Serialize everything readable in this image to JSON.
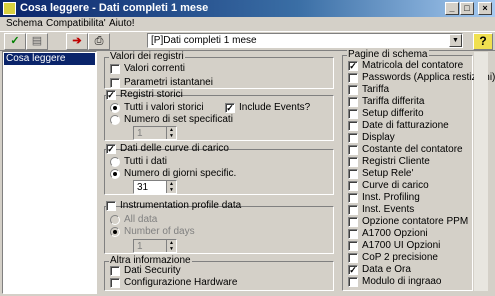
{
  "window": {
    "title": "Cosa leggere - Dati completi 1 mese"
  },
  "menu": [
    "Schema",
    "Compatibilita'",
    "Aiuto!"
  ],
  "toolbar": {
    "profile": "[P]Dati completi 1 mese",
    "help_label": "?"
  },
  "sidebar": {
    "items": [
      "Cosa leggere"
    ]
  },
  "valori_registri": {
    "title": "Valori dei registri",
    "items": [
      {
        "label": "Valori correnti",
        "checked": false
      },
      {
        "label": "Parametri istantanei",
        "checked": false
      }
    ]
  },
  "registri_storici": {
    "title": "Registri storici",
    "checked": true,
    "opt_all": "Tutti i valori storici",
    "opt_num": "Numero di set specificati",
    "include_events": "Include Events?",
    "spin_value": "1"
  },
  "curve_carico": {
    "title": "Dati delle curve di carico",
    "checked": true,
    "opt_all": "Tutti i dati",
    "opt_num": "Numero di giorni specific.",
    "spin_value": "31"
  },
  "instrumentation": {
    "title": "Instrumentation profile data",
    "checked": false,
    "opt_all": "All data",
    "opt_num": "Number of days",
    "spin_value": "1"
  },
  "altra_info": {
    "title": "Altra informazione",
    "items": [
      {
        "label": "Dati Security",
        "checked": false
      },
      {
        "label": "Configurazione Hardware",
        "checked": false
      }
    ]
  },
  "pagine_schema": {
    "title": "Pagine di schema",
    "items": [
      {
        "label": "Matricola del contatore",
        "checked": true
      },
      {
        "label": "Passwords (Applica restizioni)",
        "checked": false
      },
      {
        "label": "Tariffa",
        "checked": false
      },
      {
        "label": "Tariffa differita",
        "checked": false
      },
      {
        "label": "Setup differito",
        "checked": false
      },
      {
        "label": "Date di fatturazione",
        "checked": false
      },
      {
        "label": "Display",
        "checked": false
      },
      {
        "label": "Costante del contatore",
        "checked": false
      },
      {
        "label": "Registri Cliente",
        "checked": false
      },
      {
        "label": "Setup Rele'",
        "checked": false
      },
      {
        "label": "Curve di carico",
        "checked": false
      },
      {
        "label": "Inst. Profiling",
        "checked": false
      },
      {
        "label": "Inst. Events",
        "checked": false
      },
      {
        "label": "Opzione contatore PPM",
        "checked": false
      },
      {
        "label": "A1700 Opzioni",
        "checked": false
      },
      {
        "label": "A1700 UI Opzioni",
        "checked": false
      },
      {
        "label": "CoP 2 precisione",
        "checked": false
      },
      {
        "label": "Data e Ora",
        "checked": true
      },
      {
        "label": "Modulo di ingraao",
        "checked": false
      }
    ]
  }
}
